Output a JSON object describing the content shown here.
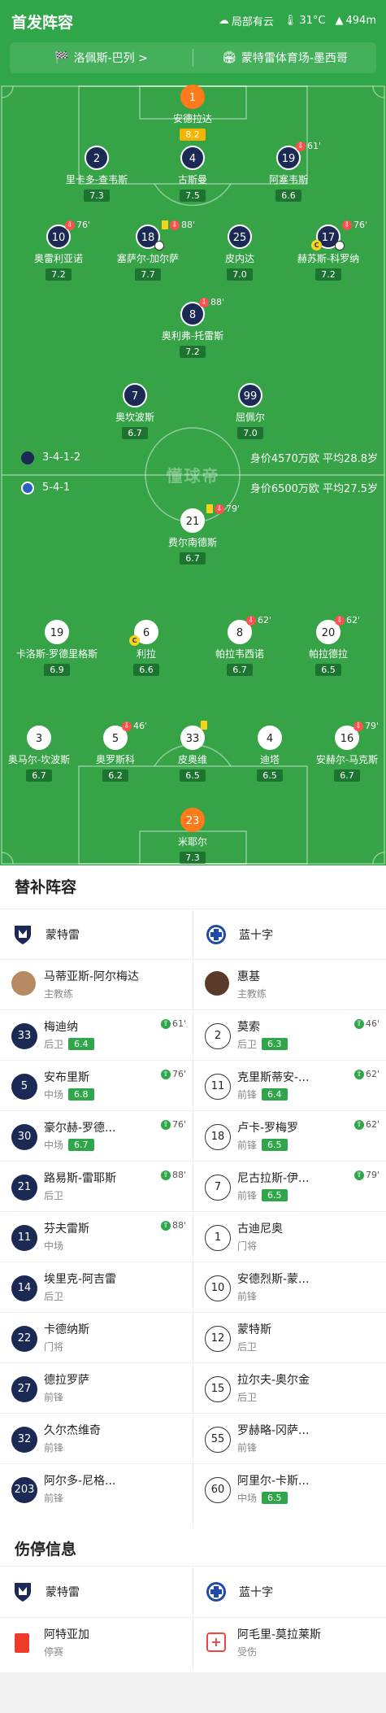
{
  "header": {
    "title": "首发阵容",
    "weather": "局部有云",
    "temperature": "31°C",
    "altitude": "494m",
    "referee": "洛佩斯-巴列 >",
    "venue": "蒙特雷体育场-墨西哥"
  },
  "pitch": {
    "watermark": "懂球帝",
    "home_team_line": {
      "formation": "3-4-1-2",
      "value": "身价4570万欧 平均28.8岁"
    },
    "away_team_line": {
      "formation": "5-4-1",
      "value": "身价6500万欧 平均27.5岁"
    },
    "home_players": [
      {
        "num": "1",
        "name": "安德拉达",
        "rating": "8.2"
      },
      {
        "num": "2",
        "name": "里卡多-查韦斯",
        "rating": "7.3"
      },
      {
        "num": "4",
        "name": "古斯曼",
        "rating": "7.5"
      },
      {
        "num": "19",
        "name": "阿塞韦斯",
        "rating": "6.6",
        "sub": "61'"
      },
      {
        "num": "10",
        "name": "奥雷利亚诺",
        "rating": "7.2",
        "sub": "76'"
      },
      {
        "num": "18",
        "name": "塞萨尔-加尔萨",
        "rating": "7.7",
        "sub": "88'"
      },
      {
        "num": "25",
        "name": "皮内达",
        "rating": "7.0"
      },
      {
        "num": "17",
        "name": "赫苏斯-科罗纳",
        "rating": "7.2",
        "sub": "76'"
      },
      {
        "num": "8",
        "name": "奥利弗-托雷斯",
        "rating": "7.2",
        "sub": "88'"
      },
      {
        "num": "7",
        "name": "奥坎波斯",
        "rating": "6.7"
      },
      {
        "num": "99",
        "name": "屈佩尔",
        "rating": "7.0"
      }
    ],
    "away_players": [
      {
        "num": "21",
        "name": "费尔南德斯",
        "rating": "6.7",
        "sub": "79'"
      },
      {
        "num": "19",
        "name": "卡洛斯-罗德里格斯",
        "rating": "6.9"
      },
      {
        "num": "6",
        "name": "利拉",
        "rating": "6.6"
      },
      {
        "num": "8",
        "name": "帕拉韦西诺",
        "rating": "6.7",
        "sub": "62'"
      },
      {
        "num": "20",
        "name": "帕拉德拉",
        "rating": "6.5",
        "sub": "62'"
      },
      {
        "num": "3",
        "name": "奥马尔-坎波斯",
        "rating": "6.7"
      },
      {
        "num": "5",
        "name": "奥罗斯科",
        "rating": "6.2",
        "sub": "46'"
      },
      {
        "num": "33",
        "name": "皮奥维",
        "rating": "6.5"
      },
      {
        "num": "4",
        "name": "迪塔",
        "rating": "6.5"
      },
      {
        "num": "16",
        "name": "安赫尔-马克斯",
        "rating": "6.7",
        "sub": "79'"
      },
      {
        "num": "23",
        "name": "米耶尔",
        "rating": "7.3"
      }
    ]
  },
  "subs": {
    "title": "替补阵容",
    "home": {
      "team": "蒙特雷",
      "coach": {
        "name": "马蒂亚斯-阿尔梅达",
        "role": "主教练"
      },
      "players": [
        {
          "num": "33",
          "name": "梅迪纳",
          "pos": "后卫",
          "rating": "6.4",
          "in": "61'"
        },
        {
          "num": "5",
          "name": "安布里斯",
          "pos": "中场",
          "rating": "6.8",
          "in": "76'"
        },
        {
          "num": "30",
          "name": "豪尔赫-罗德...",
          "pos": "中场",
          "rating": "6.7",
          "in": "76'"
        },
        {
          "num": "21",
          "name": "路易斯-雷耶斯",
          "pos": "后卫",
          "in": "88'"
        },
        {
          "num": "11",
          "name": "芬夫雷斯",
          "pos": "中场",
          "in": "88'"
        },
        {
          "num": "14",
          "name": "埃里克-阿吉雷",
          "pos": "后卫"
        },
        {
          "num": "22",
          "name": "卡德纳斯",
          "pos": "门将"
        },
        {
          "num": "27",
          "name": "德拉罗萨",
          "pos": "前锋"
        },
        {
          "num": "32",
          "name": "久尔杰维奇",
          "pos": "前锋"
        },
        {
          "num": "203",
          "name": "阿尔多-尼格...",
          "pos": "前锋"
        }
      ]
    },
    "away": {
      "team": "蓝十字",
      "coach": {
        "name": "惠基",
        "role": "主教练"
      },
      "players": [
        {
          "num": "2",
          "name": "莫索",
          "pos": "后卫",
          "rating": "6.3",
          "in": "46'"
        },
        {
          "num": "11",
          "name": "克里斯蒂安-...",
          "pos": "前锋",
          "rating": "6.4",
          "in": "62'"
        },
        {
          "num": "18",
          "name": "卢卡-罗梅罗",
          "pos": "前锋",
          "rating": "6.5",
          "in": "62'"
        },
        {
          "num": "7",
          "name": "尼古拉斯-伊...",
          "pos": "前锋",
          "rating": "6.5",
          "in": "79'"
        },
        {
          "num": "1",
          "name": "古迪尼奥",
          "pos": "门将"
        },
        {
          "num": "10",
          "name": "安德烈斯-蒙...",
          "pos": "前锋"
        },
        {
          "num": "12",
          "name": "蒙特斯",
          "pos": "后卫"
        },
        {
          "num": "15",
          "name": "拉尔夫-奥尔金",
          "pos": "后卫"
        },
        {
          "num": "55",
          "name": "罗赫略-冈萨...",
          "pos": "前锋"
        },
        {
          "num": "60",
          "name": "阿里尔-卡斯...",
          "pos": "中场",
          "rating": "6.5"
        }
      ]
    }
  },
  "injuries": {
    "title": "伤停信息",
    "home": {
      "team": "蒙特雷",
      "player": "阿特亚加",
      "status": "停赛"
    },
    "away": {
      "team": "蓝十字",
      "player": "阿毛里-莫拉莱斯",
      "status": "受伤"
    }
  },
  "colors": {
    "pitch": "#36a347",
    "navy": "#1b2a55",
    "keeper": "#ff7a1a",
    "rating": "#2fa64a"
  }
}
